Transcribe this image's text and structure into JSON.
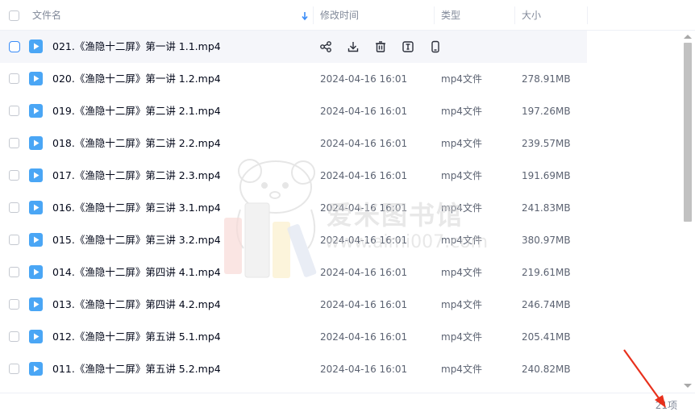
{
  "header": {
    "name_label": "文件名",
    "modified_label": "修改时间",
    "type_label": "类型",
    "size_label": "大小"
  },
  "colors": {
    "accent": "#3a8cf7",
    "file_icon": "#4aa6f5",
    "hover_row": "#f5f6fa",
    "arrow": "#e8301c"
  },
  "icons": {
    "row_actions": [
      "share-icon",
      "download-icon",
      "delete-icon",
      "rename-icon",
      "phone-icon"
    ]
  },
  "files": [
    {
      "name": "021.《渔隐十二屏》第一讲 1.1.mp4",
      "time": "",
      "type": "",
      "size": ""
    },
    {
      "name": "020.《渔隐十二屏》第一讲 1.2.mp4",
      "time": "2024-04-16 16:01",
      "type": "mp4文件",
      "size": "278.91MB"
    },
    {
      "name": "019.《渔隐十二屏》第二讲 2.1.mp4",
      "time": "2024-04-16 16:01",
      "type": "mp4文件",
      "size": "197.26MB"
    },
    {
      "name": "018.《渔隐十二屏》第二讲 2.2.mp4",
      "time": "2024-04-16 16:01",
      "type": "mp4文件",
      "size": "239.57MB"
    },
    {
      "name": "017.《渔隐十二屏》第二讲 2.3.mp4",
      "time": "2024-04-16 16:01",
      "type": "mp4文件",
      "size": "191.69MB"
    },
    {
      "name": "016.《渔隐十二屏》第三讲 3.1.mp4",
      "time": "2024-04-16 16:01",
      "type": "mp4文件",
      "size": "241.83MB"
    },
    {
      "name": "015.《渔隐十二屏》第三讲 3.2.mp4",
      "time": "2024-04-16 16:01",
      "type": "mp4文件",
      "size": "380.97MB"
    },
    {
      "name": "014.《渔隐十二屏》第四讲 4.1.mp4",
      "time": "2024-04-16 16:01",
      "type": "mp4文件",
      "size": "219.61MB"
    },
    {
      "name": "013.《渔隐十二屏》第四讲 4.2.mp4",
      "time": "2024-04-16 16:01",
      "type": "mp4文件",
      "size": "246.74MB"
    },
    {
      "name": "012.《渔隐十二屏》第五讲 5.1.mp4",
      "time": "2024-04-16 16:01",
      "type": "mp4文件",
      "size": "205.41MB"
    },
    {
      "name": "011.《渔隐十二屏》第五讲 5.2.mp4",
      "time": "2024-04-16 16:01",
      "type": "mp4文件",
      "size": "240.82MB"
    }
  ],
  "footer": {
    "count": "21项"
  },
  "watermark": {
    "title": "爱米图书馆",
    "url": "www.aimi007.com"
  }
}
